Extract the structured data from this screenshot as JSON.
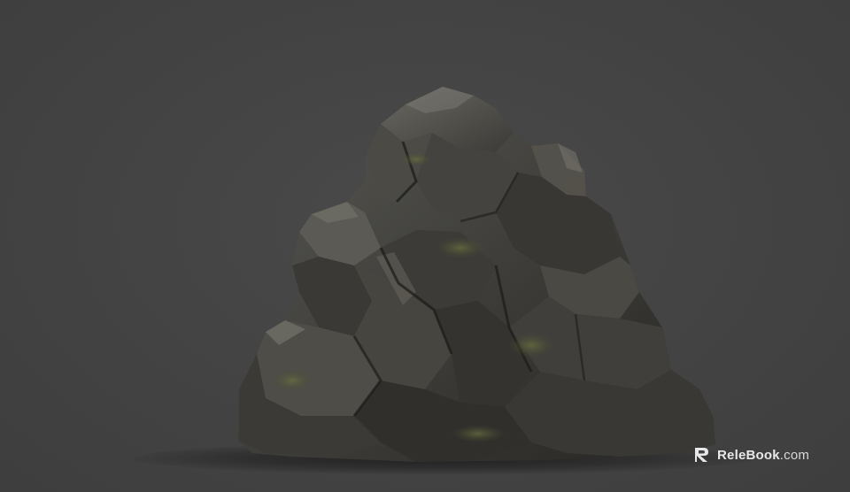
{
  "scene": {
    "background_color": "#434343",
    "subject": "rock-3d-render"
  },
  "watermark": {
    "brand": "ReleBook",
    "tld": ".com",
    "icon": "relebook-logo-icon"
  }
}
